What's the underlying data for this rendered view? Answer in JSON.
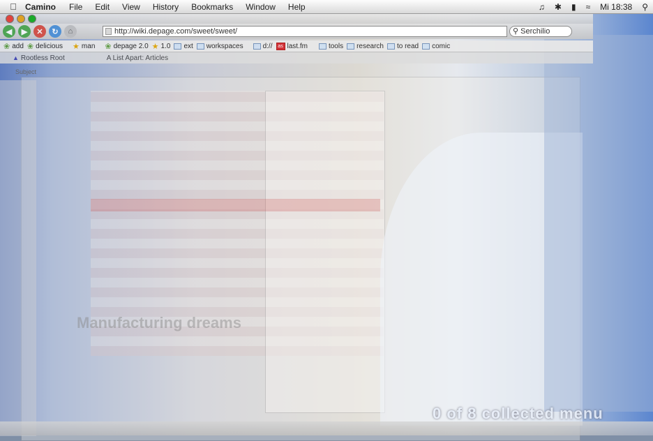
{
  "menubar": {
    "apple_icon": "apple-logo-icon",
    "app_name": "Camino",
    "menus": [
      "File",
      "Edit",
      "View",
      "History",
      "Bookmarks",
      "Window",
      "Help"
    ],
    "clock": "Mi 18:38"
  },
  "browser": {
    "url": "http://wiki.depage.com/sweet/sweet/",
    "search_placeholder": "Serchilio",
    "bookmarks": [
      {
        "label": "add",
        "icon": "leaf"
      },
      {
        "label": "delicious",
        "icon": "leaf"
      },
      {
        "label": "man",
        "icon": "star"
      },
      {
        "label": "depage 2.0",
        "icon": "leaf"
      },
      {
        "label": "1.0",
        "icon": "star"
      },
      {
        "label": "ext",
        "icon": "folder"
      },
      {
        "label": "workspaces",
        "icon": "folder"
      },
      {
        "label": "d://",
        "icon": "folder"
      },
      {
        "label": "last.fm",
        "icon": "lastfm"
      },
      {
        "label": "tools",
        "icon": "folder"
      },
      {
        "label": "research",
        "icon": "folder"
      },
      {
        "label": "to read",
        "icon": "folder"
      },
      {
        "label": "comic",
        "icon": "folder"
      }
    ],
    "tabs": [
      "Rootless Root",
      "A List Apart: Articles"
    ],
    "subject_header": "Subject"
  },
  "overlay": {
    "footer_text": "0 of 8 collected  menu",
    "ghost_heading": "Manufacturing dreams"
  },
  "colors": {
    "close": "#e0443e",
    "minimize": "#dea123",
    "zoom": "#1aab29",
    "back": "#4ca84a",
    "reload": "#4a8fd6",
    "stop": "#d84b3e"
  }
}
